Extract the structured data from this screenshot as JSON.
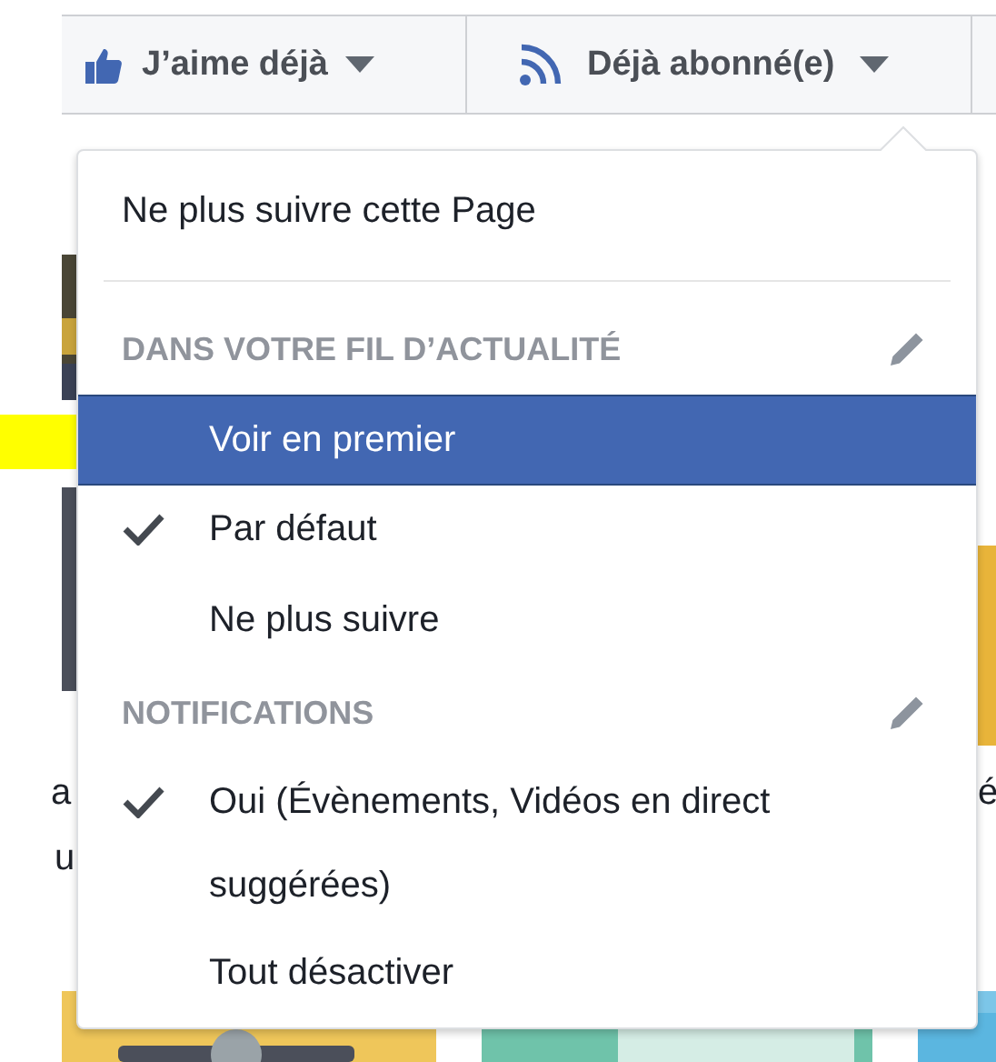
{
  "toolbar": {
    "buttons": [
      {
        "label": "J’aime déjà"
      },
      {
        "label": "Déjà abonné(e)"
      }
    ]
  },
  "background": {
    "kind": "picture",
    "fragments": [
      "a",
      "u",
      "é"
    ]
  },
  "menu": {
    "items": [
      {
        "kind": "action",
        "label": "Ne plus suivre cette Page"
      },
      {
        "kind": "divider"
      },
      {
        "kind": "header",
        "label": "DANS VOTRE FIL D’ACTUALITÉ",
        "editable": true
      },
      {
        "kind": "option",
        "label": "Voir en premier",
        "checked": false,
        "selected": true
      },
      {
        "kind": "option",
        "label": "Par défaut",
        "checked": true,
        "selected": false
      },
      {
        "kind": "option",
        "label": "Ne plus suivre",
        "checked": false,
        "selected": false
      },
      {
        "kind": "header",
        "label": "NOTIFICATIONS",
        "editable": true
      },
      {
        "kind": "option",
        "label": "Oui (Évènements, Vidéos en direct suggérées)",
        "checked": true,
        "selected": false
      },
      {
        "kind": "option",
        "label": "Tout désactiver",
        "checked": false,
        "selected": false
      }
    ]
  }
}
